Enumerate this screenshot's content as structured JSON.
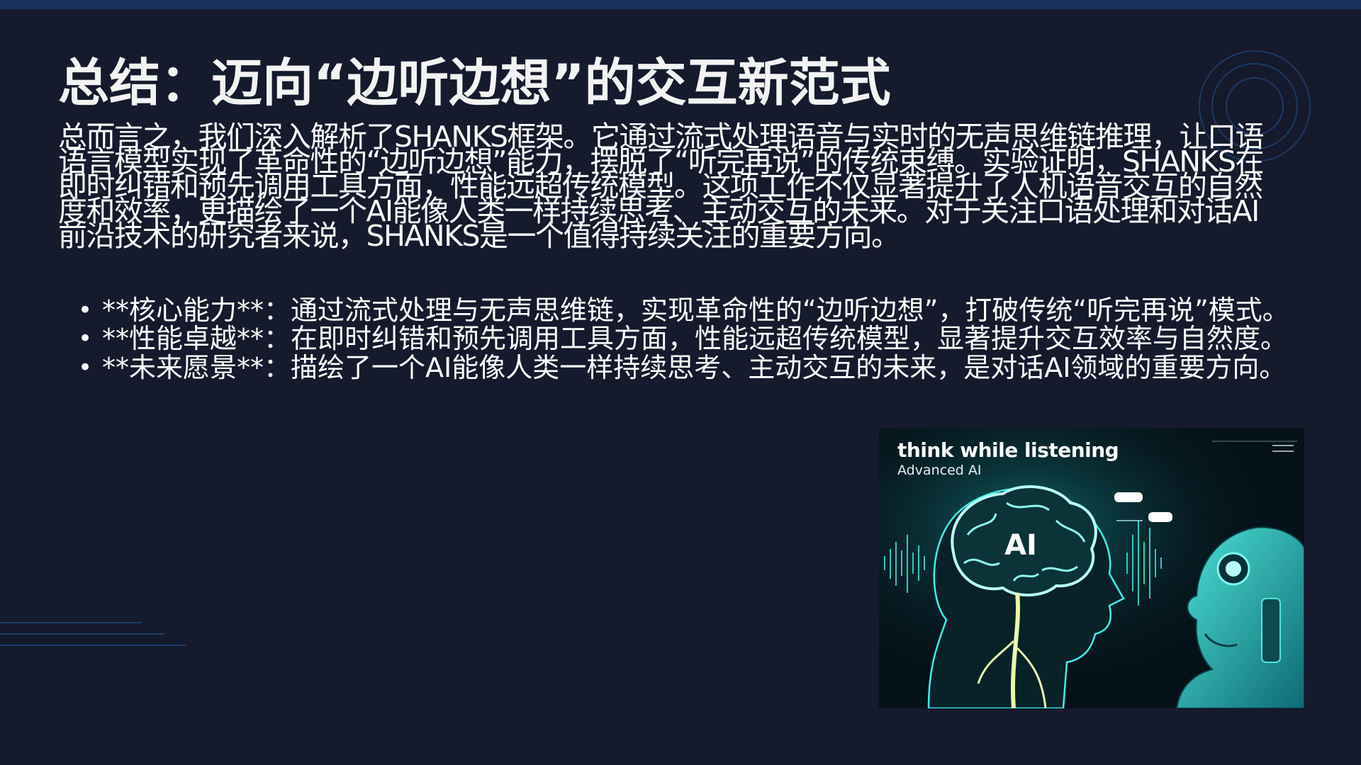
{
  "slide": {
    "title": "总结：迈向“边听边想”的交互新范式",
    "paragraph": "总而言之，我们深入解析了SHANKS框架。它通过流式处理语音与实时的无声思维链推理，让口语语言模型实现了革命性的“边听边想”能力，摆脱了“听完再说”的传统束缚。实验证明，SHANKS在即时纠错和预先调用工具方面，性能远超传统模型。这项工作不仅显著提升了人机语音交互的自然度和效率，更描绘了一个AI能像人类一样持续思考、主动交互的未来。对于关注口语处理和对话AI前沿技术的研究者来说，SHANKS是一个值得持续关注的重要方向。",
    "bullets": [
      {
        "text": "**核心能力**：通过流式处理与无声思维链，实现革命性的“边听边想”，打破传统“听完再说”模式。"
      },
      {
        "text": "**性能卓越**：在即时纠错和预先调用工具方面，性能远超传统模型，显著提升交互效率与自然度。"
      },
      {
        "text": "**未来愿景**：描绘了一个AI能像人类一样持续思考、主动交互的未来，是对话AI领域的重要方向。"
      }
    ],
    "bullet_marker": "•"
  },
  "illustration": {
    "title": "think while listening",
    "subtitle": "Advanced AI",
    "brain_label": "AI",
    "description_icon": "ai-brain-robot-illustration"
  },
  "colors": {
    "background": "#151a2c",
    "top_bar": "#18335d",
    "text": "#ffffff",
    "accent_glow": "#3ff0e6"
  }
}
